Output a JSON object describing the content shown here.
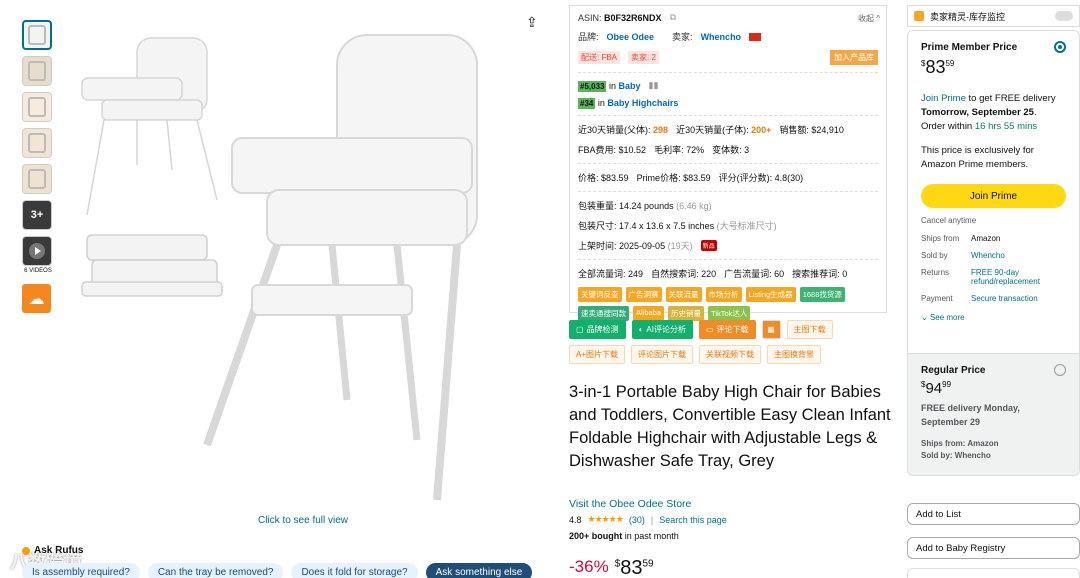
{
  "thumbnails": {
    "more_count": "3+",
    "videos_label": "6 VIDEOS"
  },
  "main_image": {
    "full_view_link": "Click to see full view"
  },
  "rufus": {
    "label": "Ask Rufus",
    "chips": [
      "Is assembly required?",
      "Can the tray be removed?",
      "Does it fold for storage?",
      "Ask something else"
    ],
    "watermark": "八数跨境"
  },
  "plugin": {
    "asin_label": "ASIN:",
    "asin": "B0F32R6NDX",
    "collapse": "收起",
    "brand_label": "品牌:",
    "brand": "Obee Odee",
    "seller_label": "卖家:",
    "seller": "Whencho",
    "fulfillment": "配送: FBA",
    "seller_count": "卖家: 2",
    "add_to_library": "加入产品库",
    "rank1": "#5,033",
    "rank1_in": "in",
    "rank1_cat": "Baby",
    "rank2": "#34",
    "rank2_in": "in",
    "rank2_cat": "Baby Highchairs",
    "sales30_label": "近30天销量(父体):",
    "sales30": "298",
    "sales30_child_label": "近30天销量(子体):",
    "sales30_child": "200+",
    "revenue_label": "销售额:",
    "revenue": "$24,910",
    "fba_label": "FBA费用:",
    "fba": "$10.52",
    "margin_label": "毛利率:",
    "margin": "72%",
    "variants_label": "变体数:",
    "variants": "3",
    "price_label": "价格:",
    "price": "$83.59",
    "prime_price_label": "Prime价格:",
    "prime_price": "$83.59",
    "rating_label": "评分(评分数):",
    "rating": "4.8(30)",
    "weight_label": "包装重量:",
    "weight": "14.24 pounds",
    "weight_kg": "(6.46 kg)",
    "size_label": "包装尺寸:",
    "size": "17.4 x 13.6 x 7.5 inches",
    "size_note": "(大号标准尺寸)",
    "launch_label": "上架时间:",
    "launch": "2025-09-05",
    "launch_days": "(19天)",
    "new_badge": "新品",
    "kw_all_label": "全部流量词:",
    "kw_all": "249",
    "kw_natural_label": "自然搜索词:",
    "kw_natural": "220",
    "kw_ad_label": "广告流量词:",
    "kw_ad": "60",
    "kw_rec_label": "搜索推荐词:",
    "kw_rec": "0",
    "tags": [
      "关键词反查",
      "广告洞察",
      "关联流量",
      "市场分析",
      "Listing生成器",
      "1688找货源",
      "速卖通搜同款",
      "Alibaba",
      "历史销量",
      "TikTok达人"
    ]
  },
  "tools_row1": [
    "品牌检测",
    "AI评论分析",
    "评论下载",
    "主图下载"
  ],
  "tools_row2": [
    "A+图片下载",
    "评论图片下载",
    "关联视频下载",
    "主图换背景"
  ],
  "product": {
    "title": "3-in-1 Portable Baby High Chair for Babies and Toddlers, Convertible Easy Clean Infant Foldable Highchair with Adjustable Legs & Dishwasher Safe Tray, Grey",
    "store_link": "Visit the Obee Odee Store",
    "rating": "4.8",
    "stars": "★★★★★",
    "review_count": "(30)",
    "search_page": "Search this page",
    "bought_bold": "200+ bought",
    "bought_rest": " in past month",
    "discount": "-36%",
    "price_symbol": "$",
    "price_whole": "83",
    "price_frac": "59"
  },
  "extension": {
    "title": "卖家精灵-库存监控"
  },
  "buybox": {
    "prime_title": "Prime Member Price",
    "price_symbol": "$",
    "price_whole": "83",
    "price_frac": "59",
    "join_prime_link": "Join Prime",
    "delivery_text": " to get FREE delivery ",
    "delivery_date": "Tomorrow, September 25",
    "order_within": "Order within ",
    "countdown": "16 hrs 55 mins",
    "exclusive_note": "This price is exclusively for Amazon Prime members.",
    "join_button": "Join Prime",
    "cancel": "Cancel anytime",
    "ships_from_label": "Ships from",
    "ships_from": "Amazon",
    "sold_by_label": "Sold by",
    "sold_by": "Whencho",
    "returns_label": "Returns",
    "returns": "FREE 90-day refund/replacement",
    "payment_label": "Payment",
    "payment": "Secure transaction",
    "see_more": "See more",
    "regular_title": "Regular Price",
    "regular_whole": "94",
    "regular_frac": "99",
    "regular_delivery": "FREE delivery Monday, September 29",
    "regular_ships": "Ships from: Amazon",
    "regular_sold": "Sold by: Whencho"
  },
  "add_to_list": "Add to List",
  "add_to_registry": "Add to Baby Registry",
  "colors": {
    "link": "#007185",
    "prime_yellow": "#FFD814",
    "discount": "#CC0C39",
    "star": "#FF9900"
  }
}
